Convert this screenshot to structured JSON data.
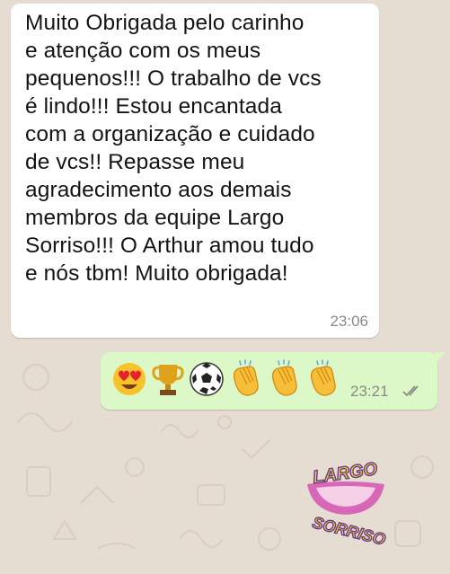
{
  "incoming_message": {
    "text": "Muito Obrigada pelo carinho\ne atenção com os meus\npequenos!!! O trabalho de vcs\né lindo!!! Estou encantada\ncom a organização e cuidado\nde vcs!! Repasse meu\nagradecimento aos demais\nmembros da equipe Largo\nSorriso!!! O Arthur amou tudo\ne nós tbm! Muito obrigada!",
    "time": "23:06"
  },
  "outgoing_message": {
    "emojis": [
      "heart-eyes-emoji",
      "trophy-emoji",
      "soccer-ball-emoji",
      "clapping-hands-emoji",
      "clapping-hands-emoji",
      "clapping-hands-emoji"
    ],
    "time": "23:21",
    "status_icon": "double-check-icon",
    "status": "delivered"
  },
  "logo": {
    "line1": "LARGO",
    "line2": "SORRISO",
    "colors": {
      "text": "#f3d51d",
      "outline": "#6a3b8c",
      "lips": "#d768b7",
      "smile": "#f4cfe6"
    }
  },
  "theme": {
    "chat_background": "#e6ddd2",
    "incoming_bubble": "#ffffff",
    "outgoing_bubble": "#dcf8c6",
    "timestamp": "#8a8a8a"
  }
}
